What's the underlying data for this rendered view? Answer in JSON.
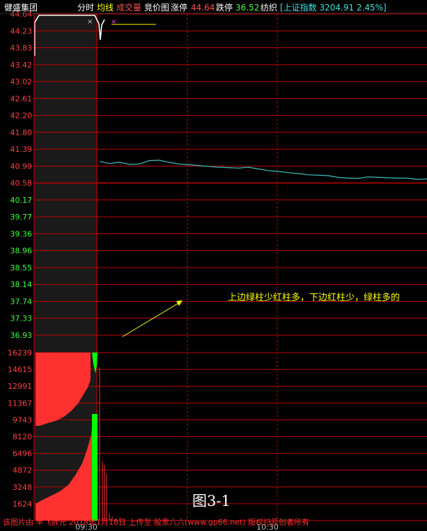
{
  "header": {
    "stock_name": "健盛集团",
    "tab_fenshi": "分时",
    "tab_junxian": "均线",
    "tab_chengjiaoliang": "成交量",
    "tab_jingjiatu": "竞价图",
    "limit_up_label": "涨停",
    "limit_up_value": "44.64",
    "limit_down_label": "跌停",
    "limit_down_value": "36.52",
    "sector": "纺织",
    "index_text": "[上证指数 3204.91 2.45%]"
  },
  "figure_label": "图3-1",
  "annotation": "上边绿柱少红柱多，下边红柱少，绿柱多的",
  "footer_text": "该图片由 半飞拆元 2018年1月18日 上传至 股票六六(www.gp66.net) 版权归原创者所有",
  "colors": {
    "background": "#000000",
    "grid_red": "#c00000",
    "price_line": "#40c0c0",
    "up_red": "#ff3030",
    "down_green": "#00ff00",
    "axis_up": "#ff4040",
    "axis_down": "#40ff40",
    "ref_white": "#ffffff"
  },
  "chart_data": [
    {
      "type": "line",
      "name": "intraday-price",
      "price_ticks_up": [
        "44.64",
        "44.23",
        "43.83",
        "43.42",
        "43.02",
        "42.61",
        "42.20",
        "41.80",
        "41.39",
        "40.99",
        "40.58"
      ],
      "price_ticks_down": [
        "40.17",
        "39.77",
        "39.36",
        "38.96",
        "38.55",
        "38.14",
        "37.74",
        "37.33",
        "36.93"
      ],
      "ylim": [
        36.93,
        44.64
      ],
      "x_tick_labels": [
        "09:30",
        "10:30"
      ],
      "x": [
        "09:30",
        "09:33",
        "09:36",
        "09:40",
        "09:45",
        "09:50",
        "09:55",
        "10:00",
        "10:05",
        "10:10",
        "10:15",
        "10:20",
        "10:25",
        "10:30",
        "10:35",
        "10:40",
        "10:45",
        "10:50",
        "10:55",
        "11:00",
        "11:05",
        "11:10",
        "11:15",
        "11:20",
        "11:25",
        "11:30",
        "11:35",
        "11:40",
        "11:45",
        "11:50",
        "11:55",
        "12:00",
        "12:05",
        "12:10"
      ],
      "values": [
        41.1,
        41.05,
        41.08,
        41.03,
        41.04,
        41.12,
        41.13,
        41.08,
        41.04,
        41.02,
        41.0,
        40.98,
        40.96,
        40.95,
        40.94,
        40.96,
        40.92,
        40.88,
        40.86,
        40.83,
        40.81,
        40.78,
        40.77,
        40.76,
        40.72,
        40.7,
        40.69,
        40.73,
        40.72,
        40.71,
        40.7,
        40.7,
        40.67,
        40.68
      ]
    },
    {
      "type": "bar",
      "name": "auction-volume",
      "volume_ticks": [
        "16239",
        "14615",
        "12991",
        "11367",
        "9743",
        "8120",
        "6496",
        "4872",
        "3248",
        "1624"
      ],
      "ylim": [
        0,
        16239
      ]
    }
  ]
}
